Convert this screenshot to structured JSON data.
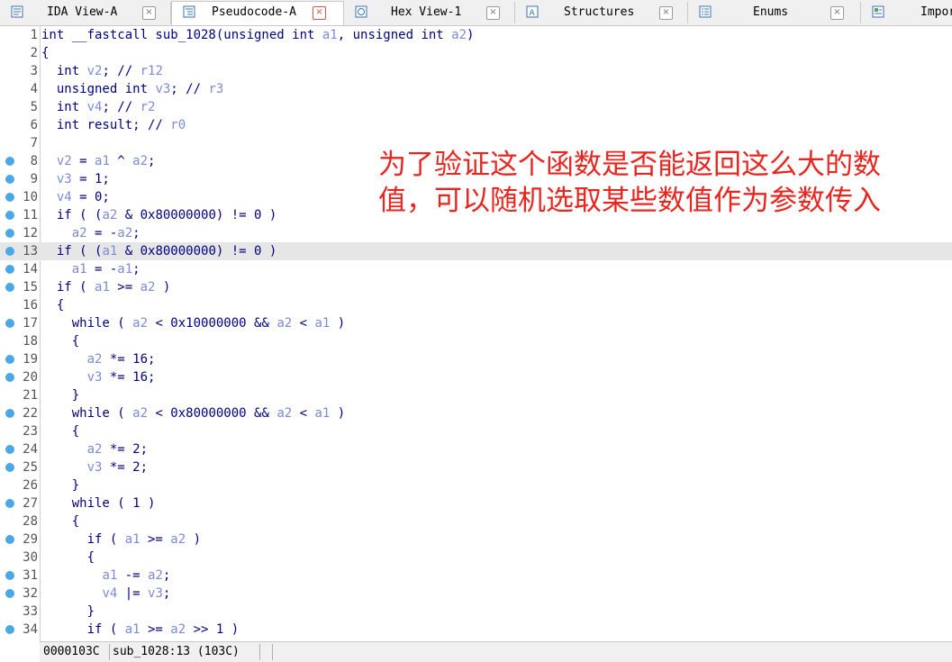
{
  "tabs": [
    {
      "label": "IDA View-A",
      "icon": "disassembly-icon",
      "active": false
    },
    {
      "label": "Pseudocode-A",
      "icon": "pseudocode-icon",
      "active": true
    },
    {
      "label": "Hex View-1",
      "icon": "hex-view-icon",
      "active": false
    },
    {
      "label": "Structures",
      "icon": "structures-icon",
      "active": false
    },
    {
      "label": "Enums",
      "icon": "enums-icon",
      "active": false
    },
    {
      "label": "Impor",
      "icon": "imports-icon",
      "active": false
    }
  ],
  "close_glyph": "×",
  "code_lines": [
    {
      "n": "1",
      "bp": false,
      "text": "int __fastcall sub_1028(unsigned int a1, unsigned int a2)"
    },
    {
      "n": "2",
      "bp": false,
      "text": "{"
    },
    {
      "n": "3",
      "bp": false,
      "text": "  int v2; // r12"
    },
    {
      "n": "4",
      "bp": false,
      "text": "  unsigned int v3; // r3"
    },
    {
      "n": "5",
      "bp": false,
      "text": "  int v4; // r2"
    },
    {
      "n": "6",
      "bp": false,
      "text": "  int result; // r0"
    },
    {
      "n": "7",
      "bp": false,
      "text": ""
    },
    {
      "n": "8",
      "bp": true,
      "text": "  v2 = a1 ^ a2;"
    },
    {
      "n": "9",
      "bp": true,
      "text": "  v3 = 1;"
    },
    {
      "n": "10",
      "bp": true,
      "text": "  v4 = 0;"
    },
    {
      "n": "11",
      "bp": true,
      "text": "  if ( (a2 & 0x80000000) != 0 )"
    },
    {
      "n": "12",
      "bp": true,
      "text": "    a2 = -a2;"
    },
    {
      "n": "13",
      "bp": true,
      "text": "  if ( (a1 & 0x80000000) != 0 )",
      "highlight": true
    },
    {
      "n": "14",
      "bp": true,
      "text": "    a1 = -a1;"
    },
    {
      "n": "15",
      "bp": true,
      "text": "  if ( a1 >= a2 )"
    },
    {
      "n": "16",
      "bp": false,
      "text": "  {"
    },
    {
      "n": "17",
      "bp": true,
      "text": "    while ( a2 < 0x10000000 && a2 < a1 )"
    },
    {
      "n": "18",
      "bp": false,
      "text": "    {"
    },
    {
      "n": "19",
      "bp": true,
      "text": "      a2 *= 16;"
    },
    {
      "n": "20",
      "bp": true,
      "text": "      v3 *= 16;"
    },
    {
      "n": "21",
      "bp": false,
      "text": "    }"
    },
    {
      "n": "22",
      "bp": true,
      "text": "    while ( a2 < 0x80000000 && a2 < a1 )"
    },
    {
      "n": "23",
      "bp": false,
      "text": "    {"
    },
    {
      "n": "24",
      "bp": true,
      "text": "      a2 *= 2;"
    },
    {
      "n": "25",
      "bp": true,
      "text": "      v3 *= 2;"
    },
    {
      "n": "26",
      "bp": false,
      "text": "    }"
    },
    {
      "n": "27",
      "bp": true,
      "text": "    while ( 1 )"
    },
    {
      "n": "28",
      "bp": false,
      "text": "    {"
    },
    {
      "n": "29",
      "bp": true,
      "text": "      if ( a1 >= a2 )"
    },
    {
      "n": "30",
      "bp": false,
      "text": "      {"
    },
    {
      "n": "31",
      "bp": true,
      "text": "        a1 -= a2;"
    },
    {
      "n": "32",
      "bp": true,
      "text": "        v4 |= v3;"
    },
    {
      "n": "33",
      "bp": false,
      "text": "      }"
    },
    {
      "n": "34",
      "bp": true,
      "text": "      if ( a1 >= a2 >> 1 )"
    }
  ],
  "annotation": {
    "line1": "为了验证这个函数是否能返回这么大的数",
    "line2": "值，可以随机选取某些数值作为参数传入"
  },
  "status": {
    "address": "0000103C",
    "location": "sub_1028:13 (103C)"
  },
  "colors": {
    "keyword": "#000080",
    "variable": "#7b8bd6",
    "annotation": "#e8251f",
    "breakpoint_dot": "#4aa8e8",
    "current_line": "#e6e6e6"
  }
}
